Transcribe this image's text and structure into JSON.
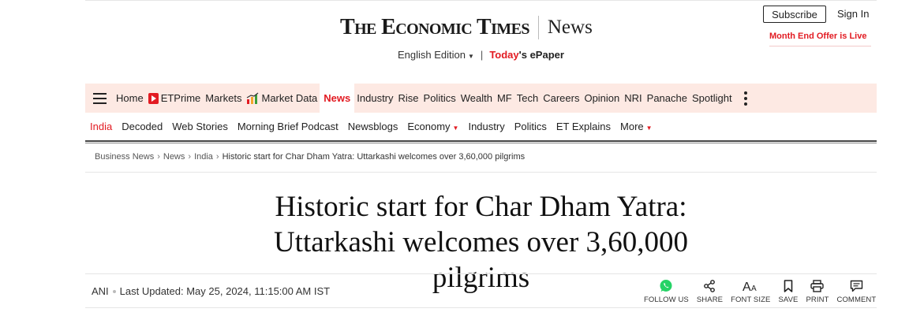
{
  "masthead": {
    "logo": "The Economic Times",
    "section": "News",
    "edition": "English Edition",
    "epaper_prefix": "Today",
    "epaper_suffix": "'s ePaper",
    "subscribe": "Subscribe",
    "signin": "Sign In",
    "offer": "Month End Offer is Live"
  },
  "mainnav": {
    "items": [
      "Home",
      "ETPrime",
      "Markets",
      "Market Data",
      "News",
      "Industry",
      "Rise",
      "Politics",
      "Wealth",
      "MF",
      "Tech",
      "Careers",
      "Opinion",
      "NRI",
      "Panache",
      "Spotlight"
    ],
    "active": "News"
  },
  "subnav": {
    "items": [
      "India",
      "Decoded",
      "Web Stories",
      "Morning Brief Podcast",
      "Newsblogs",
      "Economy",
      "Industry",
      "Politics",
      "ET Explains",
      "More"
    ],
    "current": "India"
  },
  "breadcrumb": [
    "Business News",
    "News",
    "India",
    "Historic start for Char Dham Yatra: Uttarkashi welcomes over 3,60,000 pilgrims"
  ],
  "article": {
    "headline": "Historic start for Char Dham Yatra: Uttarkashi welcomes over 3,60,000 pilgrims",
    "agency": "ANI",
    "updated": "Last Updated: May 25, 2024, 11:15:00 AM IST"
  },
  "actions": {
    "follow": "FOLLOW US",
    "share": "SHARE",
    "font": "FONT SIZE",
    "save": "SAVE",
    "print": "PRINT",
    "comment": "COMMENT"
  },
  "colors": {
    "accent": "#e21b22",
    "nav_bg": "#fde9e3",
    "whatsapp": "#25d366"
  }
}
